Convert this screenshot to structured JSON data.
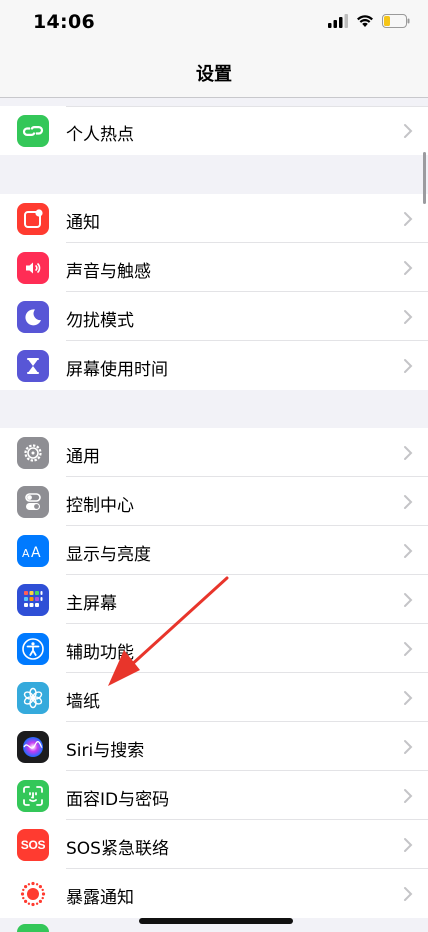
{
  "status": {
    "time": "14:06"
  },
  "nav": {
    "title": "设置"
  },
  "groups": [
    {
      "items": [
        {
          "label": "个人热点",
          "icon": "hotspot-icon",
          "color": "#34c759"
        }
      ]
    },
    {
      "items": [
        {
          "label": "通知",
          "icon": "notifications-icon",
          "color": "#ff3b30"
        },
        {
          "label": "声音与触感",
          "icon": "sounds-icon",
          "color": "#ff2d55"
        },
        {
          "label": "勿扰模式",
          "icon": "moon-icon",
          "color": "#5856d6"
        },
        {
          "label": "屏幕使用时间",
          "icon": "hourglass-icon",
          "color": "#5856d6"
        }
      ]
    },
    {
      "items": [
        {
          "label": "通用",
          "icon": "gear-icon",
          "color": "#8e8e93"
        },
        {
          "label": "控制中心",
          "icon": "toggles-icon",
          "color": "#8e8e93"
        },
        {
          "label": "显示与亮度",
          "icon": "display-icon",
          "color": "#007aff"
        },
        {
          "label": "主屏幕",
          "icon": "home-screen-icon",
          "color": "#2f4fd6"
        },
        {
          "label": "辅助功能",
          "icon": "accessibility-icon",
          "color": "#007aff"
        },
        {
          "label": "墙纸",
          "icon": "wallpaper-flower-icon",
          "color": "#35aadc"
        },
        {
          "label": "Siri与搜索",
          "icon": "siri-icon",
          "color": "#1c1c1e"
        },
        {
          "label": "面容ID与密码",
          "icon": "face-id-icon",
          "color": "#34c759"
        },
        {
          "label": "SOS紧急联络",
          "icon": "sos-icon",
          "color": "#ff3b30",
          "icon_text": "SOS"
        },
        {
          "label": "暴露通知",
          "icon": "exposure-notification-icon",
          "color": "#ffffff"
        }
      ]
    }
  ],
  "annotation": {
    "arrow_color": "#e8352b"
  }
}
